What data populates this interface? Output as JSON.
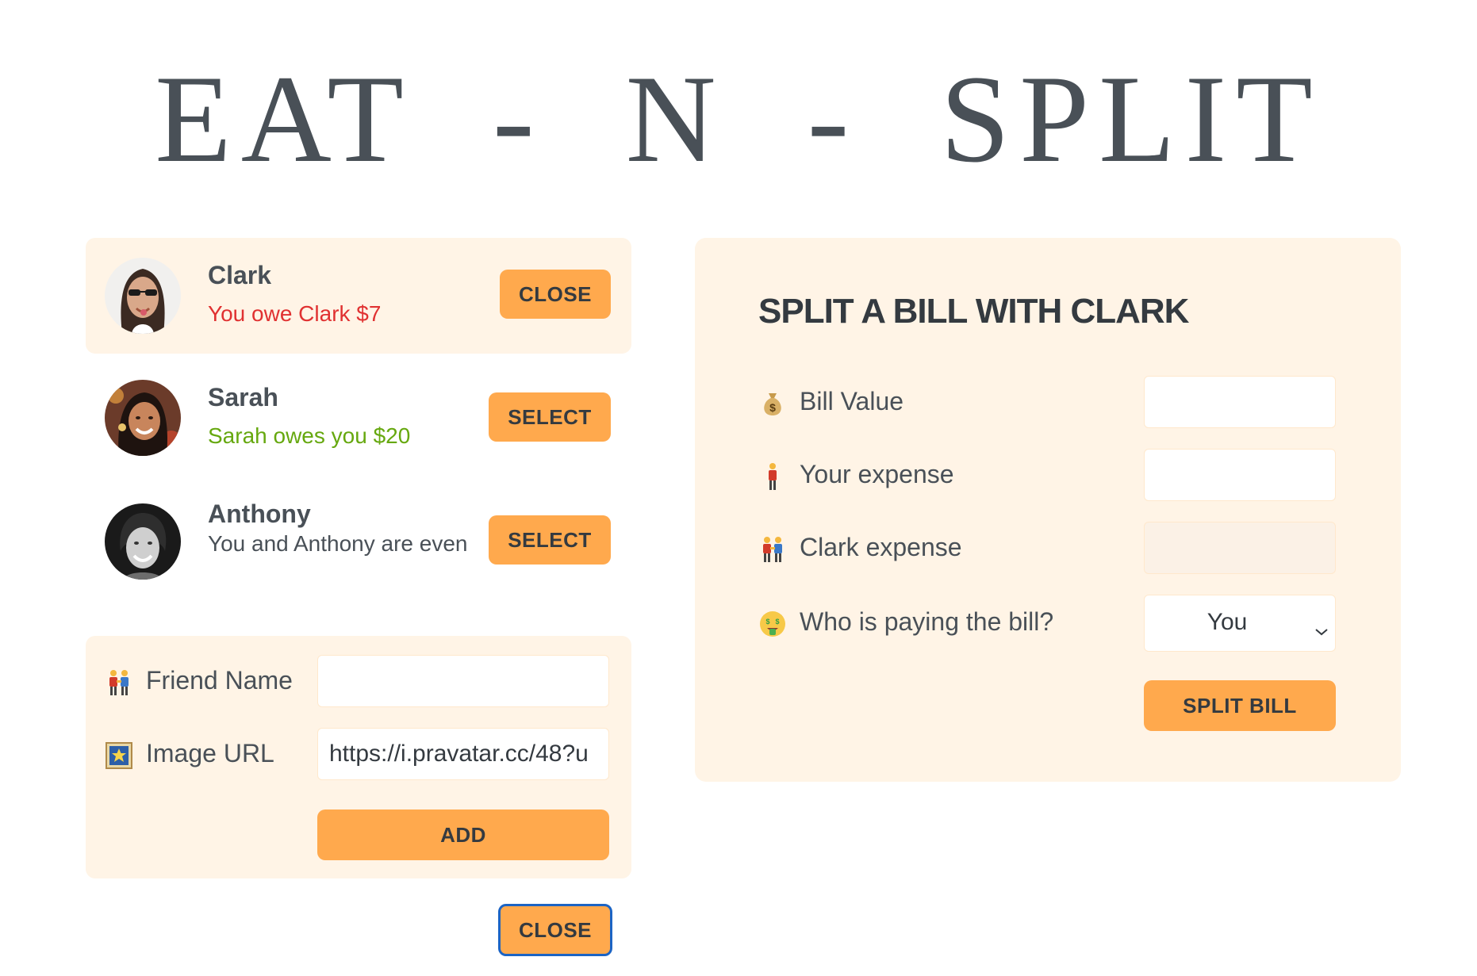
{
  "app": {
    "title": "EAT  -  N  -  SPLIT"
  },
  "friends": [
    {
      "name": "Clark",
      "status": "You owe Clark $7",
      "status_tone": "negative",
      "button_label": "CLOSE",
      "selected": true
    },
    {
      "name": "Sarah",
      "status": "Sarah owes you $20",
      "status_tone": "positive",
      "button_label": "SELECT",
      "selected": false
    },
    {
      "name": "Anthony",
      "status": "You and Anthony are even",
      "status_tone": "neutral",
      "button_label": "SELECT",
      "selected": false
    }
  ],
  "add_friend": {
    "name_label": "Friend Name",
    "name_icon": "people-holding-hands-icon",
    "name_value": "",
    "image_label": "Image URL",
    "image_icon": "framed-picture-icon",
    "image_value": "https://i.pravatar.cc/48?u",
    "add_label": "ADD"
  },
  "toggle_add_form": {
    "label": "CLOSE"
  },
  "split_bill": {
    "heading": "SPLIT A BILL WITH CLARK",
    "bill_label": "Bill Value",
    "bill_icon": "money-bag-icon",
    "bill_value": "",
    "your_expense_label": "Your expense",
    "your_expense_icon": "person-standing-icon",
    "your_expense_value": "",
    "friend_expense_label": "Clark expense",
    "friend_expense_icon": "people-holding-hands-icon",
    "friend_expense_value": "",
    "payer_label": "Who is paying the bill?",
    "payer_icon": "money-mouth-face-icon",
    "payer_selected": "You",
    "submit_label": "SPLIT BILL"
  },
  "colors": {
    "accent": "#ffa94d",
    "panel_background": "#fff4e6",
    "text": "#495057",
    "negative": "#e03131",
    "positive": "#66a80f",
    "focus_ring": "#1c64c4"
  }
}
